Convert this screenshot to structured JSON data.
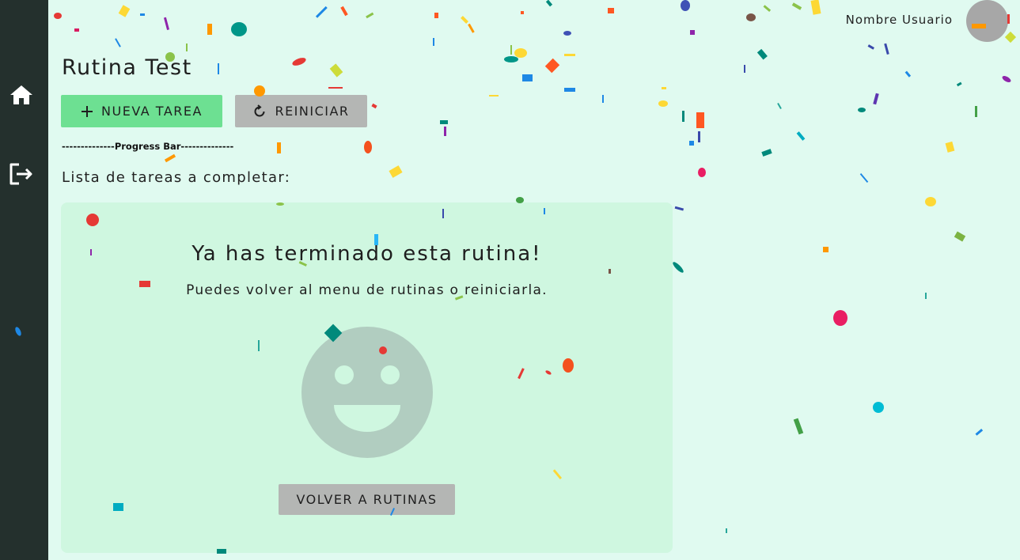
{
  "header": {
    "user_name": "Nombre Usuario"
  },
  "sidebar": {
    "items": [
      {
        "icon": "home-icon"
      },
      {
        "icon": "logout-icon"
      }
    ]
  },
  "page": {
    "title": "Rutina Test",
    "progress_text": "--------------Progress Bar--------------",
    "list_heading": "Lista de tareas a completar:"
  },
  "toolbar": {
    "new_task_label": "NUEVA TAREA",
    "new_task_icon": "plus-icon",
    "reset_label": "REINICIAR",
    "reset_icon": "refresh-icon"
  },
  "completion": {
    "title": "Ya has terminado esta rutina!",
    "subtitle": "Puedes volver al menu de rutinas o reiniciarla.",
    "icon": "smiley-face-icon",
    "back_label": "VOLVER A RUTINAS"
  },
  "colors": {
    "sidebar_bg": "#24302d",
    "page_bg": "#e0faf0",
    "card_bg": "#cff7e0",
    "primary_button": "#6de092",
    "secondary_button": "#b4b6b4",
    "avatar": "#a7a7a7",
    "smiley": "#b1cdc0"
  }
}
